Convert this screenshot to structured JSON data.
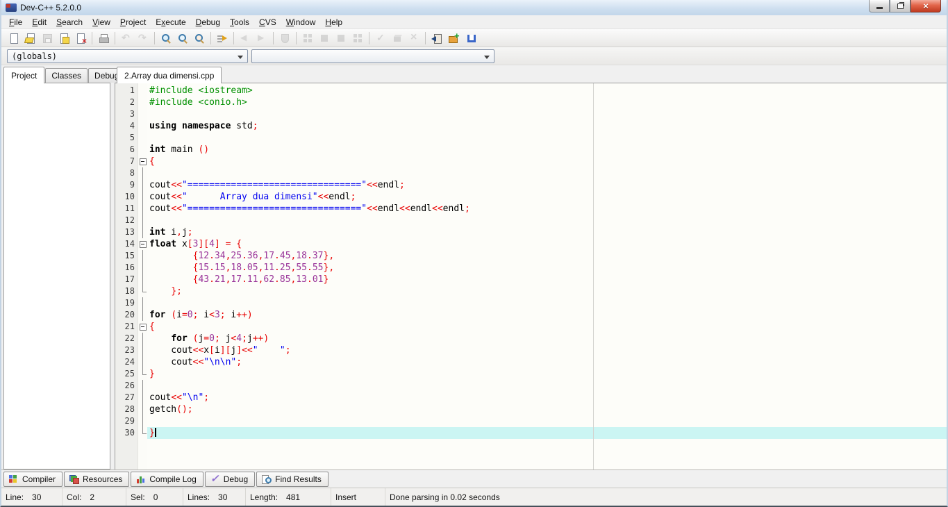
{
  "window": {
    "title": "Dev-C++ 5.2.0.0",
    "controls": [
      {
        "name": "minimize"
      },
      {
        "name": "restore"
      },
      {
        "name": "close"
      }
    ]
  },
  "menubar": {
    "items": [
      {
        "pre": "",
        "key": "F",
        "post": "ile"
      },
      {
        "pre": "",
        "key": "E",
        "post": "dit"
      },
      {
        "pre": "",
        "key": "S",
        "post": "earch"
      },
      {
        "pre": "",
        "key": "V",
        "post": "iew"
      },
      {
        "pre": "",
        "key": "P",
        "post": "roject"
      },
      {
        "pre": "E",
        "key": "x",
        "post": "ecute"
      },
      {
        "pre": "",
        "key": "D",
        "post": "ebug"
      },
      {
        "pre": "",
        "key": "T",
        "post": "ools"
      },
      {
        "pre": "",
        "key": "C",
        "post": "VS"
      },
      {
        "pre": "",
        "key": "W",
        "post": "indow"
      },
      {
        "pre": "",
        "key": "H",
        "post": "elp"
      }
    ]
  },
  "toolbar": {
    "groups": [
      {
        "icons": [
          {
            "name": "new-file",
            "kind": "page",
            "disabled": false
          },
          {
            "name": "open-file",
            "kind": "page-open",
            "disabled": false
          },
          {
            "name": "save-file",
            "kind": "floppy",
            "disabled": true
          },
          {
            "name": "save-all",
            "kind": "save-all",
            "disabled": false
          },
          {
            "name": "close-file",
            "kind": "page-close",
            "disabled": false
          }
        ]
      },
      {
        "icons": [
          {
            "name": "print",
            "kind": "printer",
            "disabled": false
          }
        ]
      },
      {
        "icons": [
          {
            "name": "undo",
            "kind": "undo",
            "disabled": true
          },
          {
            "name": "redo",
            "kind": "redo",
            "disabled": true
          }
        ]
      },
      {
        "icons": [
          {
            "name": "find",
            "kind": "magnifier",
            "disabled": false
          },
          {
            "name": "find-in-files",
            "kind": "magnifier2",
            "disabled": false
          },
          {
            "name": "replace",
            "kind": "magnifier3",
            "disabled": false
          }
        ]
      },
      {
        "icons": [
          {
            "name": "goto-line",
            "kind": "goto",
            "disabled": false
          }
        ]
      },
      {
        "icons": [
          {
            "name": "back",
            "kind": "arrow-left",
            "disabled": true
          },
          {
            "name": "forward",
            "kind": "arrow-right",
            "disabled": true
          }
        ]
      },
      {
        "icons": [
          {
            "name": "profile",
            "kind": "shield",
            "disabled": true
          }
        ]
      },
      {
        "icons": [
          {
            "name": "compile",
            "kind": "grid4",
            "disabled": true
          },
          {
            "name": "run",
            "kind": "square",
            "disabled": true
          },
          {
            "name": "compile-and-run",
            "kind": "square",
            "disabled": true
          },
          {
            "name": "rebuild-all",
            "kind": "grid4",
            "disabled": true
          }
        ]
      },
      {
        "icons": [
          {
            "name": "syntax-check",
            "kind": "check",
            "disabled": true
          },
          {
            "name": "package",
            "kind": "cube",
            "disabled": true
          },
          {
            "name": "abort",
            "kind": "cross",
            "disabled": true
          }
        ]
      },
      {
        "icons": [
          {
            "name": "insert",
            "kind": "insert",
            "disabled": false
          },
          {
            "name": "add-to-project",
            "kind": "folder-plus",
            "disabled": false
          },
          {
            "name": "remove-from-project",
            "kind": "unit",
            "disabled": false
          }
        ]
      }
    ]
  },
  "combos": {
    "globals": {
      "value": "(globals)"
    },
    "members": {
      "value": ""
    }
  },
  "sidebar": {
    "tabs": [
      {
        "label": "Project",
        "active": true
      },
      {
        "label": "Classes",
        "active": false
      },
      {
        "label": "Debug",
        "active": false
      }
    ]
  },
  "editor": {
    "file_tab": "2.Array dua dimensi.cpp",
    "current_line": 30,
    "lines": [
      {
        "f": "",
        "t": [
          [
            "g",
            "#include <iostream>"
          ]
        ]
      },
      {
        "f": "",
        "t": [
          [
            "g",
            "#include <conio.h>"
          ]
        ]
      },
      {
        "f": "",
        "t": []
      },
      {
        "f": "",
        "t": [
          [
            "k",
            "using namespace"
          ],
          [
            "p",
            " std"
          ],
          [
            "r",
            ";"
          ]
        ]
      },
      {
        "f": "",
        "t": []
      },
      {
        "f": "",
        "t": [
          [
            "k",
            "int"
          ],
          [
            "p",
            " main "
          ],
          [
            "r",
            "()"
          ]
        ]
      },
      {
        "f": "s",
        "t": [
          [
            "r",
            "{"
          ]
        ]
      },
      {
        "f": "l",
        "t": []
      },
      {
        "f": "l",
        "t": [
          [
            "p",
            "cout"
          ],
          [
            "r",
            "<<"
          ],
          [
            "s",
            "\"================================\""
          ],
          [
            "r",
            "<<"
          ],
          [
            "p",
            "endl"
          ],
          [
            "r",
            ";"
          ]
        ]
      },
      {
        "f": "l",
        "t": [
          [
            "p",
            "cout"
          ],
          [
            "r",
            "<<"
          ],
          [
            "s",
            "\"      Array dua dimensi\""
          ],
          [
            "r",
            "<<"
          ],
          [
            "p",
            "endl"
          ],
          [
            "r",
            ";"
          ]
        ]
      },
      {
        "f": "l",
        "t": [
          [
            "p",
            "cout"
          ],
          [
            "r",
            "<<"
          ],
          [
            "s",
            "\"================================\""
          ],
          [
            "r",
            "<<"
          ],
          [
            "p",
            "endl"
          ],
          [
            "r",
            "<<"
          ],
          [
            "p",
            "endl"
          ],
          [
            "r",
            "<<"
          ],
          [
            "p",
            "endl"
          ],
          [
            "r",
            ";"
          ]
        ]
      },
      {
        "f": "l",
        "t": []
      },
      {
        "f": "l",
        "t": [
          [
            "k",
            "int"
          ],
          [
            "p",
            " i"
          ],
          [
            "r",
            ","
          ],
          [
            "p",
            "j"
          ],
          [
            "r",
            ";"
          ]
        ]
      },
      {
        "f": "s",
        "t": [
          [
            "k",
            "float"
          ],
          [
            "p",
            " x"
          ],
          [
            "r",
            "["
          ],
          [
            "n",
            "3"
          ],
          [
            "r",
            "]["
          ],
          [
            "n",
            "4"
          ],
          [
            "r",
            "]"
          ],
          [
            "p",
            " "
          ],
          [
            "r",
            "="
          ],
          [
            "p",
            " "
          ],
          [
            "r",
            "{"
          ]
        ]
      },
      {
        "f": "l",
        "t": [
          [
            "p",
            "        "
          ],
          [
            "r",
            "{"
          ],
          [
            "n",
            "12"
          ],
          [
            "r",
            "."
          ],
          [
            "n",
            "34"
          ],
          [
            "r",
            ","
          ],
          [
            "n",
            "25"
          ],
          [
            "r",
            "."
          ],
          [
            "n",
            "36"
          ],
          [
            "r",
            ","
          ],
          [
            "n",
            "17"
          ],
          [
            "r",
            "."
          ],
          [
            "n",
            "45"
          ],
          [
            "r",
            ","
          ],
          [
            "n",
            "18"
          ],
          [
            "r",
            "."
          ],
          [
            "n",
            "37"
          ],
          [
            "r",
            "},"
          ]
        ]
      },
      {
        "f": "l",
        "t": [
          [
            "p",
            "        "
          ],
          [
            "r",
            "{"
          ],
          [
            "n",
            "15"
          ],
          [
            "r",
            "."
          ],
          [
            "n",
            "15"
          ],
          [
            "r",
            ","
          ],
          [
            "n",
            "18"
          ],
          [
            "r",
            "."
          ],
          [
            "n",
            "05"
          ],
          [
            "r",
            ","
          ],
          [
            "n",
            "11"
          ],
          [
            "r",
            "."
          ],
          [
            "n",
            "25"
          ],
          [
            "r",
            ","
          ],
          [
            "n",
            "55"
          ],
          [
            "r",
            "."
          ],
          [
            "n",
            "55"
          ],
          [
            "r",
            "},"
          ]
        ]
      },
      {
        "f": "l",
        "t": [
          [
            "p",
            "        "
          ],
          [
            "r",
            "{"
          ],
          [
            "n",
            "43"
          ],
          [
            "r",
            "."
          ],
          [
            "n",
            "21"
          ],
          [
            "r",
            ","
          ],
          [
            "n",
            "17"
          ],
          [
            "r",
            "."
          ],
          [
            "n",
            "11"
          ],
          [
            "r",
            ","
          ],
          [
            "n",
            "62"
          ],
          [
            "r",
            "."
          ],
          [
            "n",
            "85"
          ],
          [
            "r",
            ","
          ],
          [
            "n",
            "13"
          ],
          [
            "r",
            "."
          ],
          [
            "n",
            "01"
          ],
          [
            "r",
            "}"
          ]
        ]
      },
      {
        "f": "e",
        "t": [
          [
            "p",
            "    "
          ],
          [
            "r",
            "};"
          ]
        ]
      },
      {
        "f": "l",
        "t": []
      },
      {
        "f": "l",
        "t": [
          [
            "k",
            "for"
          ],
          [
            "p",
            " "
          ],
          [
            "r",
            "("
          ],
          [
            "p",
            "i"
          ],
          [
            "r",
            "="
          ],
          [
            "n",
            "0"
          ],
          [
            "r",
            ";"
          ],
          [
            "p",
            " i"
          ],
          [
            "r",
            "<"
          ],
          [
            "n",
            "3"
          ],
          [
            "r",
            ";"
          ],
          [
            "p",
            " i"
          ],
          [
            "r",
            "++)"
          ]
        ]
      },
      {
        "f": "s",
        "t": [
          [
            "r",
            "{"
          ]
        ]
      },
      {
        "f": "l",
        "t": [
          [
            "p",
            "    "
          ],
          [
            "k",
            "for"
          ],
          [
            "p",
            " "
          ],
          [
            "r",
            "("
          ],
          [
            "p",
            "j"
          ],
          [
            "r",
            "="
          ],
          [
            "n",
            "0"
          ],
          [
            "r",
            ";"
          ],
          [
            "p",
            " j"
          ],
          [
            "r",
            "<"
          ],
          [
            "n",
            "4"
          ],
          [
            "r",
            ";"
          ],
          [
            "p",
            "j"
          ],
          [
            "r",
            "++)"
          ]
        ]
      },
      {
        "f": "l",
        "t": [
          [
            "p",
            "    cout"
          ],
          [
            "r",
            "<<"
          ],
          [
            "p",
            "x"
          ],
          [
            "r",
            "["
          ],
          [
            "p",
            "i"
          ],
          [
            "r",
            "]["
          ],
          [
            "p",
            "j"
          ],
          [
            "r",
            "]<<"
          ],
          [
            "s",
            "\"    \""
          ],
          [
            "r",
            ";"
          ]
        ]
      },
      {
        "f": "l",
        "t": [
          [
            "p",
            "    cout"
          ],
          [
            "r",
            "<<"
          ],
          [
            "s",
            "\"\\n\\n\""
          ],
          [
            "r",
            ";"
          ]
        ]
      },
      {
        "f": "e",
        "t": [
          [
            "r",
            "}"
          ]
        ]
      },
      {
        "f": "l",
        "t": []
      },
      {
        "f": "l",
        "t": [
          [
            "p",
            "cout"
          ],
          [
            "r",
            "<<"
          ],
          [
            "s",
            "\"\\n\""
          ],
          [
            "r",
            ";"
          ]
        ]
      },
      {
        "f": "l",
        "t": [
          [
            "p",
            "getch"
          ],
          [
            "r",
            "();"
          ]
        ]
      },
      {
        "f": "l",
        "t": []
      },
      {
        "f": "e",
        "t": [
          [
            "r",
            "}"
          ]
        ],
        "hl": true,
        "cur": true
      }
    ]
  },
  "bottom_tabs": [
    {
      "label": "Compiler",
      "icon": "grid-color"
    },
    {
      "label": "Resources",
      "icon": "stack-color"
    },
    {
      "label": "Compile Log",
      "icon": "chart"
    },
    {
      "label": "Debug",
      "icon": "check-purple"
    },
    {
      "label": "Find Results",
      "icon": "find-results"
    }
  ],
  "statusbar": {
    "segments": [
      {
        "name": "status-line",
        "label": "Line:",
        "value": "30"
      },
      {
        "name": "status-col",
        "label": "Col:",
        "value": "2"
      },
      {
        "name": "status-sel",
        "label": "Sel:",
        "value": "0"
      },
      {
        "name": "status-lines",
        "label": "Lines:",
        "value": "30"
      },
      {
        "name": "status-length",
        "label": "Length:",
        "value": "481"
      },
      {
        "name": "status-insert-mode",
        "label": "Insert",
        "value": ""
      },
      {
        "name": "status-message",
        "label": "Done parsing in 0.02 seconds",
        "value": ""
      }
    ]
  },
  "colors": {
    "preprocessor": "#009000",
    "symbol": "#E80000",
    "string": "#0000F0",
    "number": "#993399",
    "current_line_highlight": "#CBF5F3",
    "close_button": "#BE3A20"
  }
}
